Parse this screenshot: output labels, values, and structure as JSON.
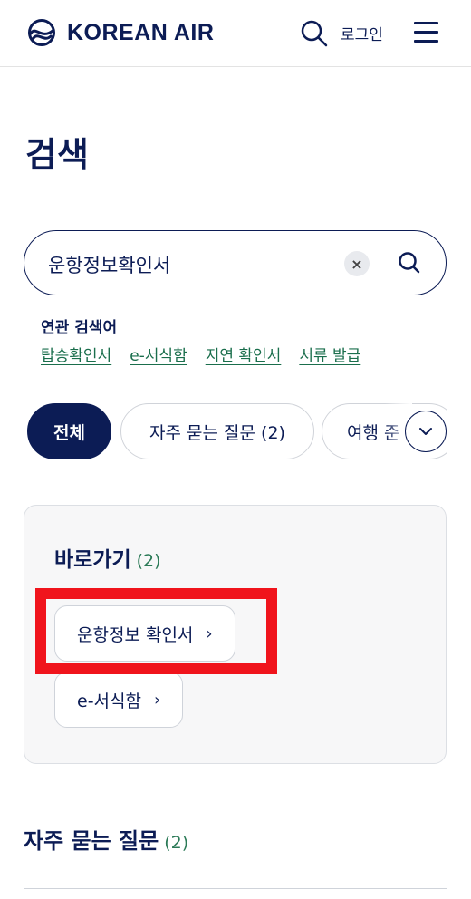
{
  "header": {
    "brand": "KOREAN AIR",
    "login_label": "로그인",
    "icons": {
      "logo": "taeguk-logo-icon",
      "search": "search-icon",
      "menu": "hamburger-menu-icon"
    }
  },
  "page": {
    "title": "검색"
  },
  "search": {
    "value": "운항정보확인서",
    "clear_label": "×"
  },
  "related": {
    "title": "연관 검색어",
    "items": [
      "탑승확인서",
      "e-서식함",
      "지연 확인서",
      "서류 발급"
    ]
  },
  "filters": {
    "items": [
      {
        "label": "전체",
        "active": true
      },
      {
        "label": "자주 묻는 질문 (2)",
        "active": false
      },
      {
        "label": "여행 준",
        "active": false
      }
    ],
    "more_icon": "chevron-down-icon"
  },
  "shortcuts": {
    "title": "바로가기",
    "count": "(2)",
    "items": [
      {
        "label": "운항정보 확인서",
        "arrow": "›"
      },
      {
        "label": "e-서식함",
        "arrow": "›"
      }
    ]
  },
  "faq": {
    "title": "자주 묻는 질문",
    "count": "(2)"
  },
  "colors": {
    "navy": "#0c1c55",
    "link_green": "#1a6e4c",
    "count_green": "#2b7a57",
    "highlight_red": "#f0141c",
    "card_bg": "#f7f7f8"
  }
}
